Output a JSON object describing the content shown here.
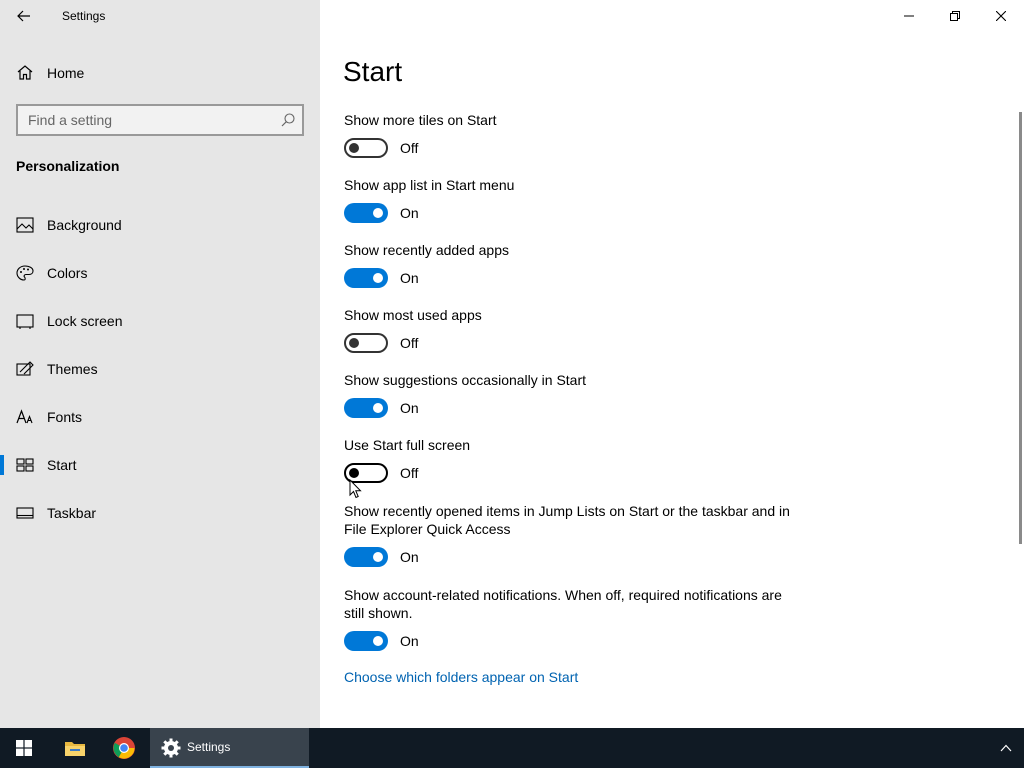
{
  "window": {
    "title": "Settings",
    "controls": {
      "minimize": "minimize-icon",
      "restore": "restore-icon",
      "close": "close-icon"
    }
  },
  "sidebar": {
    "home_label": "Home",
    "search": {
      "placeholder": "Find a setting",
      "value": ""
    },
    "section_title": "Personalization",
    "items": [
      {
        "label": "Background",
        "icon": "background-icon",
        "selected": false
      },
      {
        "label": "Colors",
        "icon": "palette-icon",
        "selected": false
      },
      {
        "label": "Lock screen",
        "icon": "lock-screen-icon",
        "selected": false
      },
      {
        "label": "Themes",
        "icon": "themes-icon",
        "selected": false
      },
      {
        "label": "Fonts",
        "icon": "fonts-icon",
        "selected": false
      },
      {
        "label": "Start",
        "icon": "start-icon",
        "selected": true
      },
      {
        "label": "Taskbar",
        "icon": "taskbar-icon",
        "selected": false
      }
    ]
  },
  "main": {
    "page_title": "Start",
    "settings": [
      {
        "title": "Show more tiles on Start",
        "on": false,
        "state_label": "Off"
      },
      {
        "title": "Show app list in Start menu",
        "on": true,
        "state_label": "On"
      },
      {
        "title": "Show recently added apps",
        "on": true,
        "state_label": "On"
      },
      {
        "title": "Show most used apps",
        "on": false,
        "state_label": "Off"
      },
      {
        "title": "Show suggestions occasionally in Start",
        "on": true,
        "state_label": "On"
      },
      {
        "title": "Use Start full screen",
        "on": false,
        "state_label": "Off"
      },
      {
        "title": "Show recently opened items in Jump Lists on Start or the taskbar and in File Explorer Quick Access",
        "on": true,
        "state_label": "On"
      },
      {
        "title": "Show account-related notifications. When off, required notifications are still shown.",
        "on": true,
        "state_label": "On"
      }
    ],
    "link": "Choose which folders appear on Start"
  },
  "taskbar": {
    "start_icon": "windows-logo-icon",
    "apps": [
      {
        "icon": "file-explorer-icon"
      },
      {
        "icon": "chrome-icon"
      }
    ],
    "active_app_label": "Settings",
    "colors": {
      "background": "#101a24",
      "active": "#39434d",
      "accent": "#0078d7"
    }
  }
}
